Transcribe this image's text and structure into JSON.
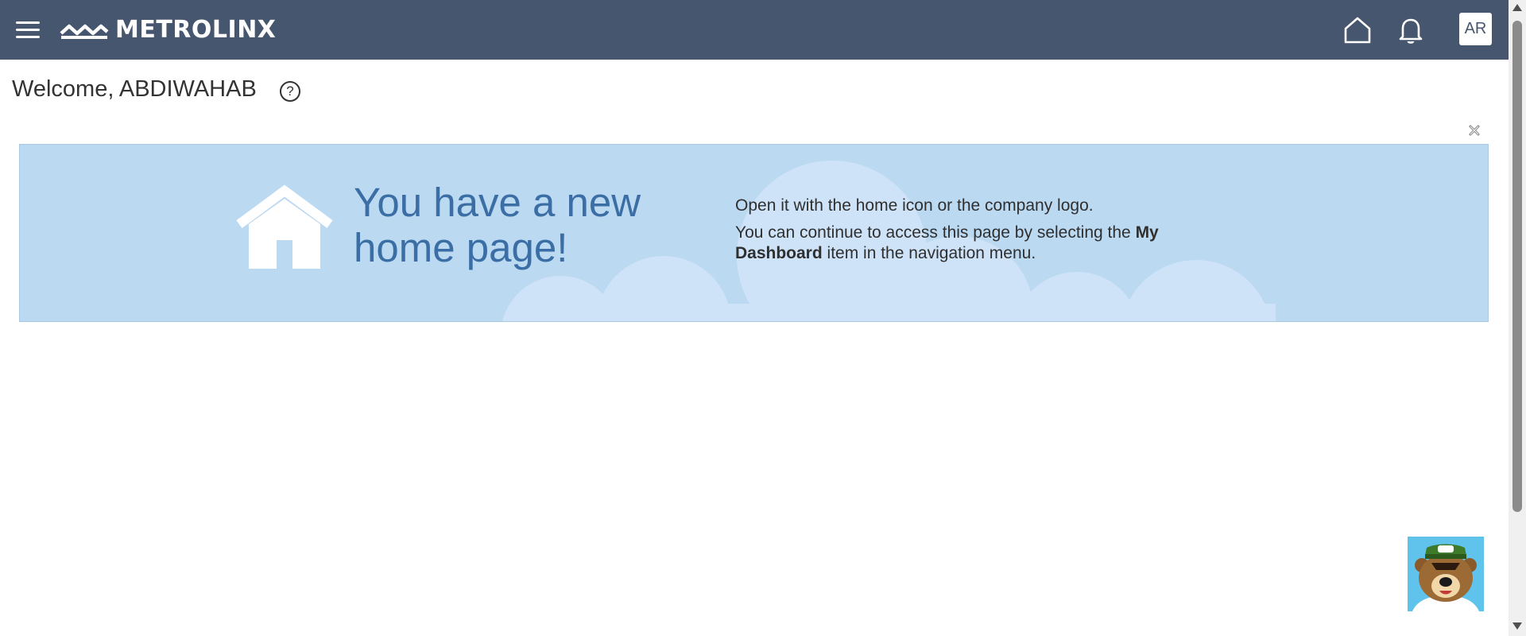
{
  "header": {
    "logo_text": "METROLINX",
    "user_initials": "AR",
    "brand_color": "#46566f"
  },
  "welcome": {
    "text": "Welcome, ABDIWAHAB",
    "help_symbol": "?"
  },
  "banner": {
    "title": "You have a new home page!",
    "line1": "Open it with the home icon or the company logo.",
    "line2_prefix": "You can continue to access this page by selecting the ",
    "line2_bold": "My Dashboard",
    "line2_suffix": " item in the navigation menu.",
    "background_color": "#bcd9f2",
    "title_color": "#3a6ea5"
  },
  "icons": {
    "menu": "hamburger-menu-icon",
    "home": "home-icon",
    "notifications": "bell-icon",
    "help": "help-icon",
    "dismiss": "close-icon",
    "assistant": "bear-mascot-icon"
  }
}
